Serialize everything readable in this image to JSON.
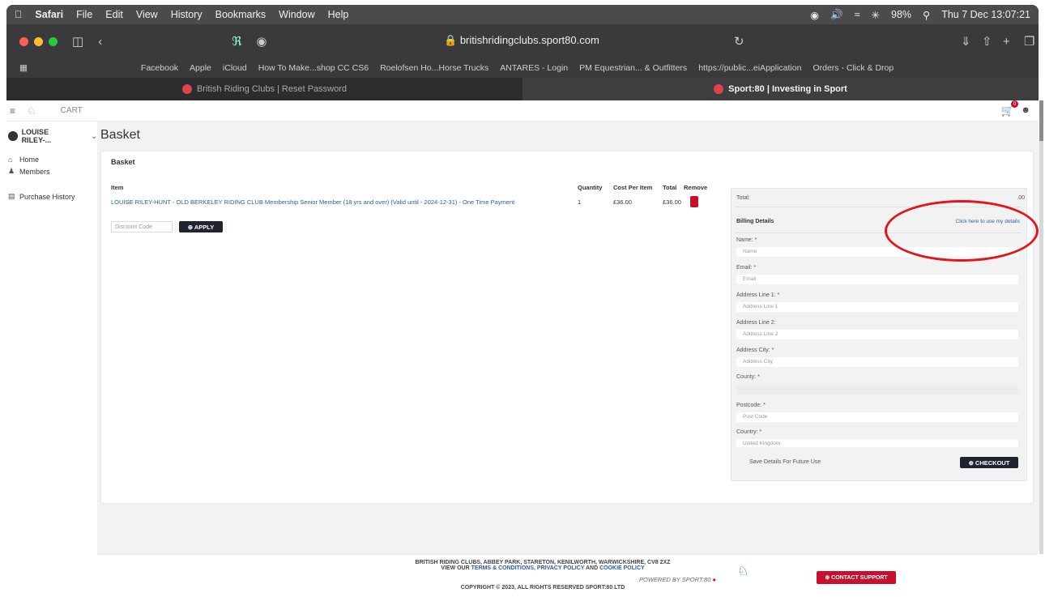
{
  "menubar": {
    "app": "Safari",
    "items": [
      "File",
      "Edit",
      "View",
      "History",
      "Bookmarks",
      "Window",
      "Help"
    ],
    "battery": "98%",
    "clock": "Thu 7 Dec  13:07:21"
  },
  "browser": {
    "url": "britishridingclubs.sport80.com",
    "favorites": [
      "Facebook",
      "Apple",
      "iCloud",
      "How To Make...shop CC CS6",
      "Roelofsen Ho...Horse Trucks",
      "ANTARES - Login",
      "PM Equestrian... & Outfitters",
      "https://public...eiApplication",
      "Orders - Click & Drop"
    ],
    "tabs": [
      "British Riding Clubs | Reset Password",
      "Sport:80 | Investing in Sport"
    ]
  },
  "appbar": {
    "title": "CART",
    "cart_count": "0"
  },
  "sidebar": {
    "user": "LOUISE RILEY-...",
    "items": [
      "Home",
      "Members",
      "Purchase History"
    ]
  },
  "basket": {
    "page_title": "Basket",
    "card_title": "Basket",
    "headers": {
      "item": "Item",
      "quantity": "Quantity",
      "cost": "Cost Per Item",
      "total": "Total",
      "remove": "Remove"
    },
    "row": {
      "item": "LOUISE RILEY-HUNT - OLD BERKELEY RIDING CLUB Membership Senior Member (18 yrs and over) (Valid until - 2024-12-31) - One Time Payment",
      "quantity": "1",
      "cost": "£36.00",
      "total": "£36.00"
    },
    "discount_placeholder": "Discount Code",
    "apply_label": "⊕ APPLY"
  },
  "billing": {
    "total_label": "Total:",
    "total_value": ".00",
    "heading": "Billing Details",
    "use_details_link": "Click here to use my details",
    "name_label": "Name: *",
    "name_placeholder": "Name",
    "email_label": "Email: *",
    "email_placeholder": "Email",
    "addr1_label": "Address Line 1: *",
    "addr1_placeholder": "Address Line 1",
    "addr2_label": "Address Line 2:",
    "addr2_placeholder": "Address Line 2",
    "city_label": "Address City: *",
    "city_placeholder": "Address City",
    "county_label": "County: *",
    "postcode_label": "Postcode: *",
    "postcode_placeholder": "Post Code",
    "country_label": "Country: *",
    "country_value": "United Kingdom",
    "save_label": "Save Details For Future Use",
    "checkout_label": "⊕ CHECKOUT"
  },
  "footer": {
    "address": "BRITISH RIDING CLUBS, ABBEY PARK, STARETON, KENILWORTH, WARWICKSHIRE, CV8 2XZ",
    "view_our": "VIEW OUR",
    "terms": "TERMS & CONDITIONS, PRIVACY POLICY",
    "and": "AND",
    "cookie": "COOKIE POLICY",
    "powered": "POWERED BY SPORT:80",
    "copyright": "COPYRIGHT © 2023, ALL RIGHTS RESERVED SPORT:80 LTD",
    "support": "⊕ CONTACT SUPPORT"
  },
  "colors": {
    "accent": "#c8102e",
    "link": "#2b5ea8",
    "annotation": "#e3141b",
    "dark_button": "#1f2430"
  }
}
